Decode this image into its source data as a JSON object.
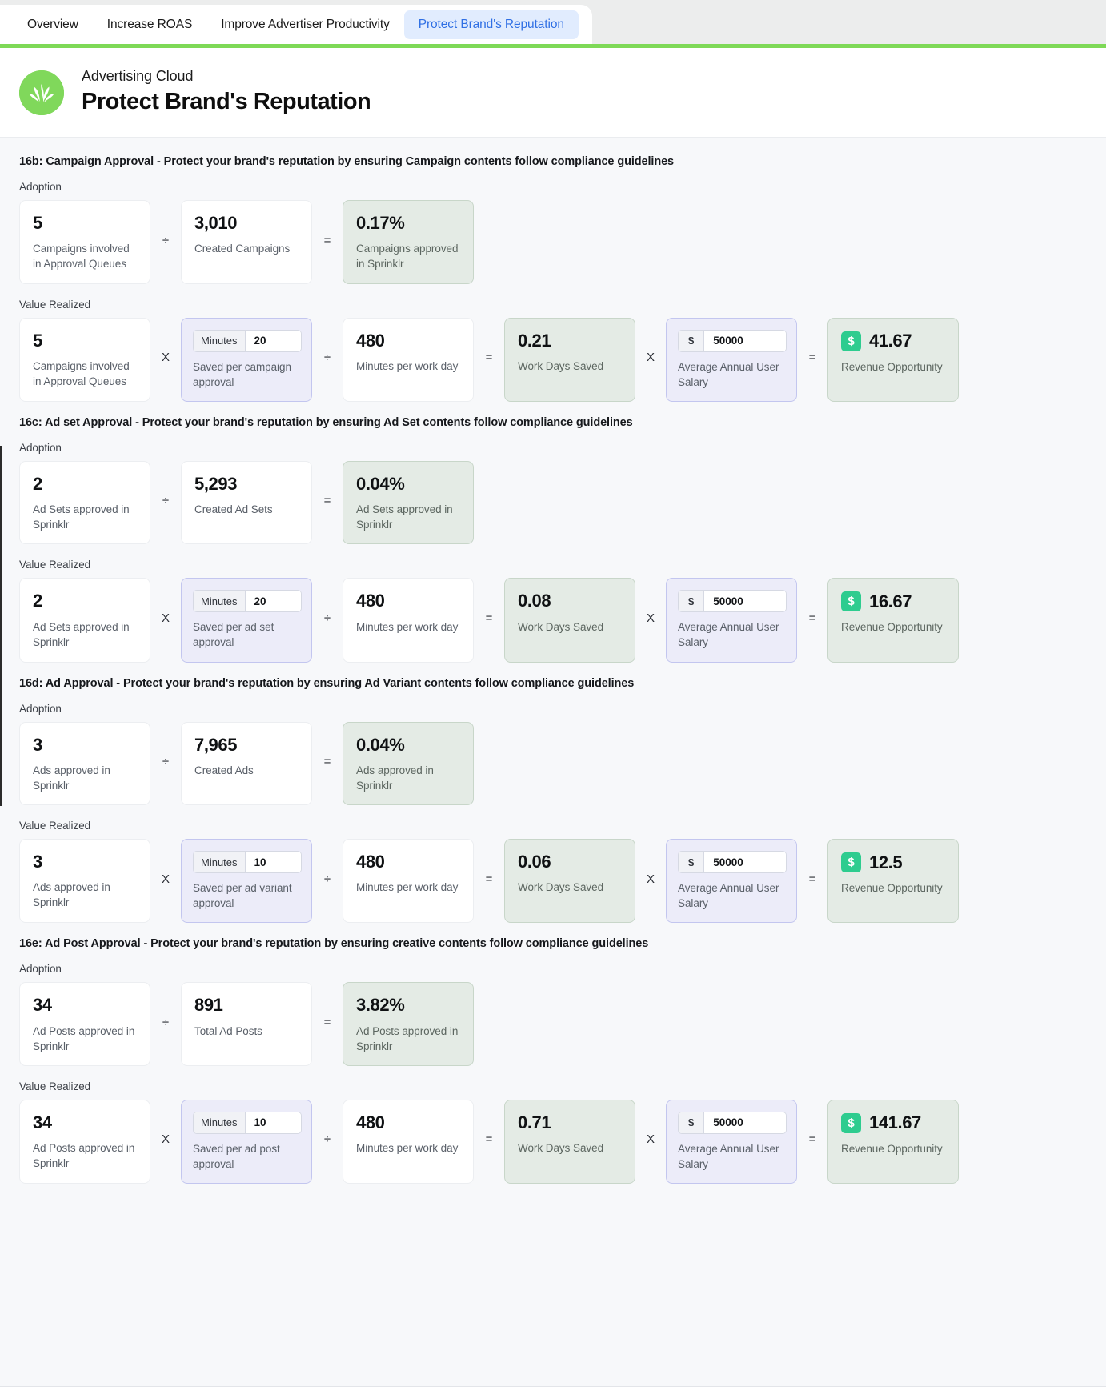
{
  "tabs": [
    {
      "label": "Overview",
      "active": false
    },
    {
      "label": "Increase ROAS",
      "active": false
    },
    {
      "label": "Improve Advertiser Productivity",
      "active": false
    },
    {
      "label": "Protect Brand's Reputation",
      "active": true
    }
  ],
  "header": {
    "eyebrow": "Advertising Cloud",
    "title": "Protect Brand's Reputation",
    "logo_icon": "sprinkler-leaf-icon",
    "accent_color": "#7ed957",
    "logo_color": "#80d85b"
  },
  "labels": {
    "adoption": "Adoption",
    "value_realized": "Value Realized",
    "op_divide": "÷",
    "op_equals": "=",
    "op_multiply": "X",
    "minutes_prefix": "Minutes",
    "dollar_prefix": "$",
    "badge_dollar": "$"
  },
  "sections": [
    {
      "id": "16b",
      "title": "16b: Campaign Approval - Protect your brand's reputation by ensuring Campaign contents follow compliance guidelines",
      "adoption": {
        "numerator": {
          "value": "5",
          "label": "Campaigns involved in Approval Queues"
        },
        "denominator": {
          "value": "3,010",
          "label": "Created Campaigns"
        },
        "result": {
          "value": "0.17%",
          "label": "Campaigns approved in Sprinklr"
        }
      },
      "value_realized": {
        "count": {
          "value": "5",
          "label": "Campaigns involved in Approval Queues"
        },
        "minutes": {
          "prefix": "Minutes",
          "value": "20",
          "label": "Saved per campaign approval"
        },
        "per_day": {
          "value": "480",
          "label": "Minutes per work day"
        },
        "days_saved": {
          "value": "0.21",
          "label": "Work Days Saved"
        },
        "salary": {
          "prefix": "$",
          "value": "50000",
          "label": "Average Annual User Salary"
        },
        "revenue": {
          "badge": "$",
          "value": "41.67",
          "label": "Revenue Opportunity"
        }
      }
    },
    {
      "id": "16c",
      "title": "16c: Ad set Approval - Protect your brand's reputation by ensuring Ad Set contents follow compliance guidelines",
      "adoption": {
        "numerator": {
          "value": "2",
          "label": "Ad Sets approved in Sprinklr"
        },
        "denominator": {
          "value": "5,293",
          "label": "Created Ad Sets"
        },
        "result": {
          "value": "0.04%",
          "label": "Ad Sets approved in Sprinklr"
        }
      },
      "value_realized": {
        "count": {
          "value": "2",
          "label": "Ad Sets approved in Sprinklr"
        },
        "minutes": {
          "prefix": "Minutes",
          "value": "20",
          "label": "Saved per ad set approval"
        },
        "per_day": {
          "value": "480",
          "label": "Minutes per work day"
        },
        "days_saved": {
          "value": "0.08",
          "label": "Work Days Saved"
        },
        "salary": {
          "prefix": "$",
          "value": "50000",
          "label": "Average Annual User Salary"
        },
        "revenue": {
          "badge": "$",
          "value": "16.67",
          "label": "Revenue Opportunity"
        }
      }
    },
    {
      "id": "16d",
      "title": "16d: Ad Approval - Protect your brand's reputation by ensuring Ad Variant contents follow compliance guidelines",
      "adoption": {
        "numerator": {
          "value": "3",
          "label": "Ads approved in Sprinklr"
        },
        "denominator": {
          "value": "7,965",
          "label": "Created Ads"
        },
        "result": {
          "value": "0.04%",
          "label": "Ads approved in Sprinklr"
        }
      },
      "value_realized": {
        "count": {
          "value": "3",
          "label": "Ads approved in Sprinklr"
        },
        "minutes": {
          "prefix": "Minutes",
          "value": "10",
          "label": "Saved per ad variant approval"
        },
        "per_day": {
          "value": "480",
          "label": "Minutes per work day"
        },
        "days_saved": {
          "value": "0.06",
          "label": "Work Days Saved"
        },
        "salary": {
          "prefix": "$",
          "value": "50000",
          "label": "Average Annual User Salary"
        },
        "revenue": {
          "badge": "$",
          "value": "12.5",
          "label": "Revenue Opportunity"
        }
      }
    },
    {
      "id": "16e",
      "title": "16e: Ad Post Approval - Protect your brand's reputation by ensuring creative contents follow compliance guidelines",
      "adoption": {
        "numerator": {
          "value": "34",
          "label": "Ad Posts approved in Sprinklr"
        },
        "denominator": {
          "value": "891",
          "label": "Total Ad Posts"
        },
        "result": {
          "value": "3.82%",
          "label": "Ad Posts approved in Sprinklr"
        }
      },
      "value_realized": {
        "count": {
          "value": "34",
          "label": "Ad Posts approved in Sprinklr"
        },
        "minutes": {
          "prefix": "Minutes",
          "value": "10",
          "label": "Saved per ad post approval"
        },
        "per_day": {
          "value": "480",
          "label": "Minutes per work day"
        },
        "days_saved": {
          "value": "0.71",
          "label": "Work Days Saved"
        },
        "salary": {
          "prefix": "$",
          "value": "50000",
          "label": "Average Annual User Salary"
        },
        "revenue": {
          "badge": "$",
          "value": "141.67",
          "label": "Revenue Opportunity"
        }
      }
    }
  ]
}
